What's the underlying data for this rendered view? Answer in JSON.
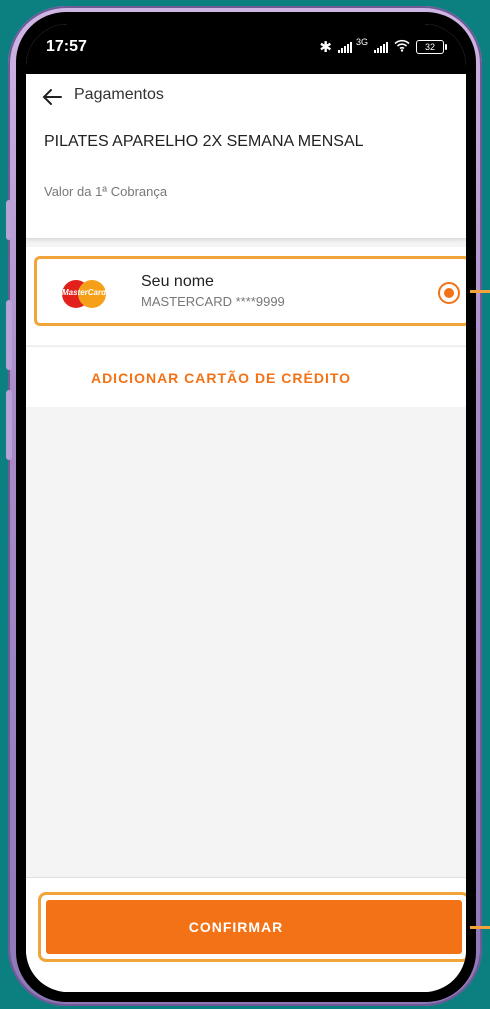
{
  "status_bar": {
    "time": "17:57",
    "network_label": "3G",
    "battery_level": "32"
  },
  "header": {
    "back_icon": "arrow-left-icon",
    "title": "Pagamentos",
    "plan_name": "PILATES APARELHO 2X SEMANA MENSAL",
    "charge_label": "Valor da 1ª Cobrança"
  },
  "card": {
    "brand_logo_text": "MasterCard",
    "holder_name": "Seu nome",
    "masked_number": "MASTERCARD ****9999",
    "selected": true
  },
  "actions": {
    "add_card_label": "ADICIONAR CARTÃO DE CRÉDITO",
    "confirm_label": "CONFIRMAR"
  },
  "colors": {
    "accent": "#f47216",
    "highlight": "#f1a43a",
    "background": "#0c7f80"
  }
}
